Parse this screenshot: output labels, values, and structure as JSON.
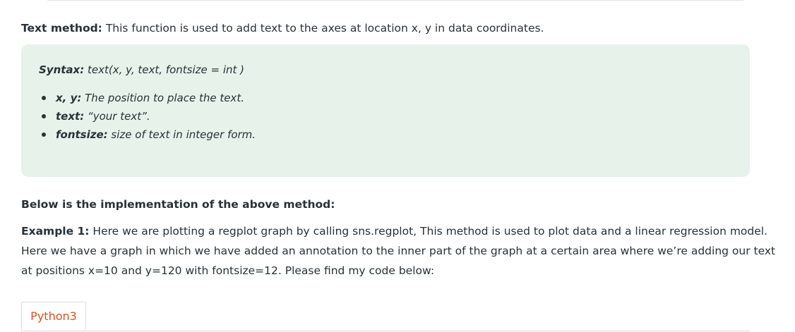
{
  "text_method": {
    "label": "Text method:",
    "description": " This function is used to add text to the axes at location x, y in data coordinates."
  },
  "syntax_box": {
    "syntax_label": "Syntax:",
    "syntax_value": " text(x, y, text, fontsize = int )",
    "params": [
      {
        "name": "x, y:",
        "desc": " The position to place the text."
      },
      {
        "name": "text:",
        "desc": " “your text”."
      },
      {
        "name": "fontsize:",
        "desc": " size of text in integer form."
      }
    ],
    "background_color": "#e7f2ea"
  },
  "implementation_heading": "Below is the implementation of the above method:",
  "example": {
    "label": "Example 1:",
    "line1": " Here we are plotting a regplot graph by calling sns.regplot, This method is used to plot data and a linear regression model.",
    "line2": "Here we have a graph in which we have added an annotation to the inner part of the graph at a certain area where we’re adding our text",
    "line3": "at positions x=10 and y=120 with fontsize=12.  Please find my code below:"
  },
  "code_tabs": [
    {
      "label": "Python3",
      "active": true
    }
  ],
  "colors": {
    "text": "#273239",
    "tab_accent": "#e04f1d"
  }
}
